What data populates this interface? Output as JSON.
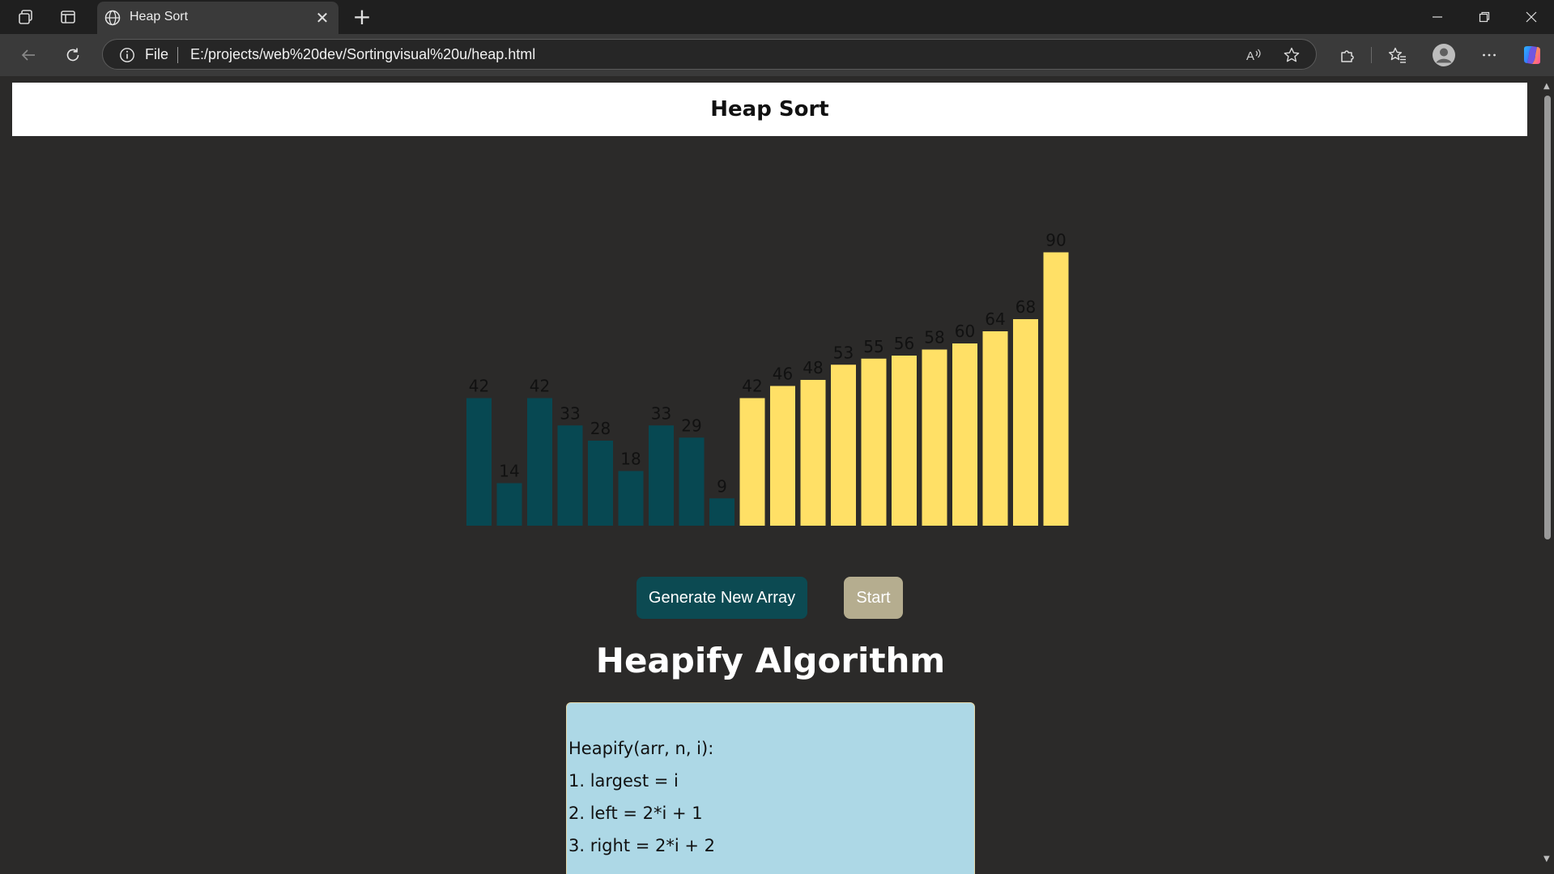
{
  "browser": {
    "tab_title": "Heap Sort",
    "address_scheme": "File",
    "address_url": "E:/projects/web%20dev/Sortingvisual%20u/heap.html",
    "icons": [
      "workspaces-icon",
      "tab-actions-icon",
      "globe-icon",
      "close-icon",
      "plus-icon",
      "minimize-icon",
      "restore-icon",
      "window-close-icon",
      "back-icon",
      "refresh-icon",
      "info-icon",
      "read-aloud-icon",
      "favorite-star-icon",
      "extensions-icon",
      "favorites-icon",
      "profile-icon",
      "more-icon",
      "copilot-icon"
    ]
  },
  "page": {
    "header_title": "Heap Sort",
    "generate_button": "Generate New Array",
    "start_button": "Start",
    "algo_title": "Heapify Algorithm",
    "code_lines": [
      "Heapify(arr, n, i):",
      "1. largest = i",
      "2. left = 2*i + 1",
      "3. right = 2*i + 2"
    ]
  },
  "colors": {
    "unsorted": "#074852",
    "sorted": "#ffe066",
    "background": "#2b2a29"
  },
  "chart_data": {
    "type": "bar",
    "values": [
      42,
      14,
      42,
      33,
      28,
      18,
      33,
      29,
      9,
      42,
      46,
      48,
      53,
      55,
      56,
      58,
      60,
      64,
      68,
      90
    ],
    "states": [
      "unsorted",
      "unsorted",
      "unsorted",
      "unsorted",
      "unsorted",
      "unsorted",
      "unsorted",
      "unsorted",
      "unsorted",
      "sorted",
      "sorted",
      "sorted",
      "sorted",
      "sorted",
      "sorted",
      "sorted",
      "sorted",
      "sorted",
      "sorted",
      "sorted"
    ]
  }
}
